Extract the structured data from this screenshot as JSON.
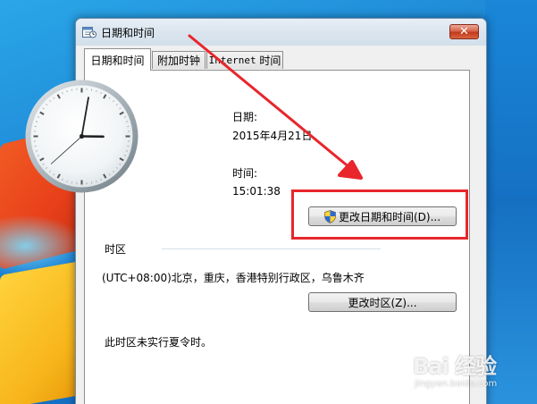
{
  "window": {
    "title": "日期和时间",
    "close_glyph": "✕"
  },
  "tabs": [
    {
      "label": "日期和时间",
      "active": true
    },
    {
      "label": "附加时钟",
      "active": false
    },
    {
      "label_prefix": "Internet",
      "label_suffix": " 时间",
      "active": false
    }
  ],
  "datetime": {
    "date_label": "日期:",
    "date_value": "2015年4月21日",
    "time_label": "时间:",
    "time_value": "15:01:38",
    "change_button": "更改日期和时间(D)..."
  },
  "timezone": {
    "section_label": "时区",
    "zone_value": "(UTC+08:00)北京，重庆，香港特别行政区，乌鲁木齐",
    "change_button": "更改时区(Z)...",
    "dst_note": "此时区未实行夏令时。"
  },
  "clock": {
    "hour": 15,
    "minute": 1,
    "second": 38
  },
  "watermark": {
    "main": "Bai 经验",
    "sub": "jingyan.baidu.com"
  },
  "colors": {
    "annotation_red": "#e8262b",
    "accent_shield": "#2a6bd1"
  }
}
